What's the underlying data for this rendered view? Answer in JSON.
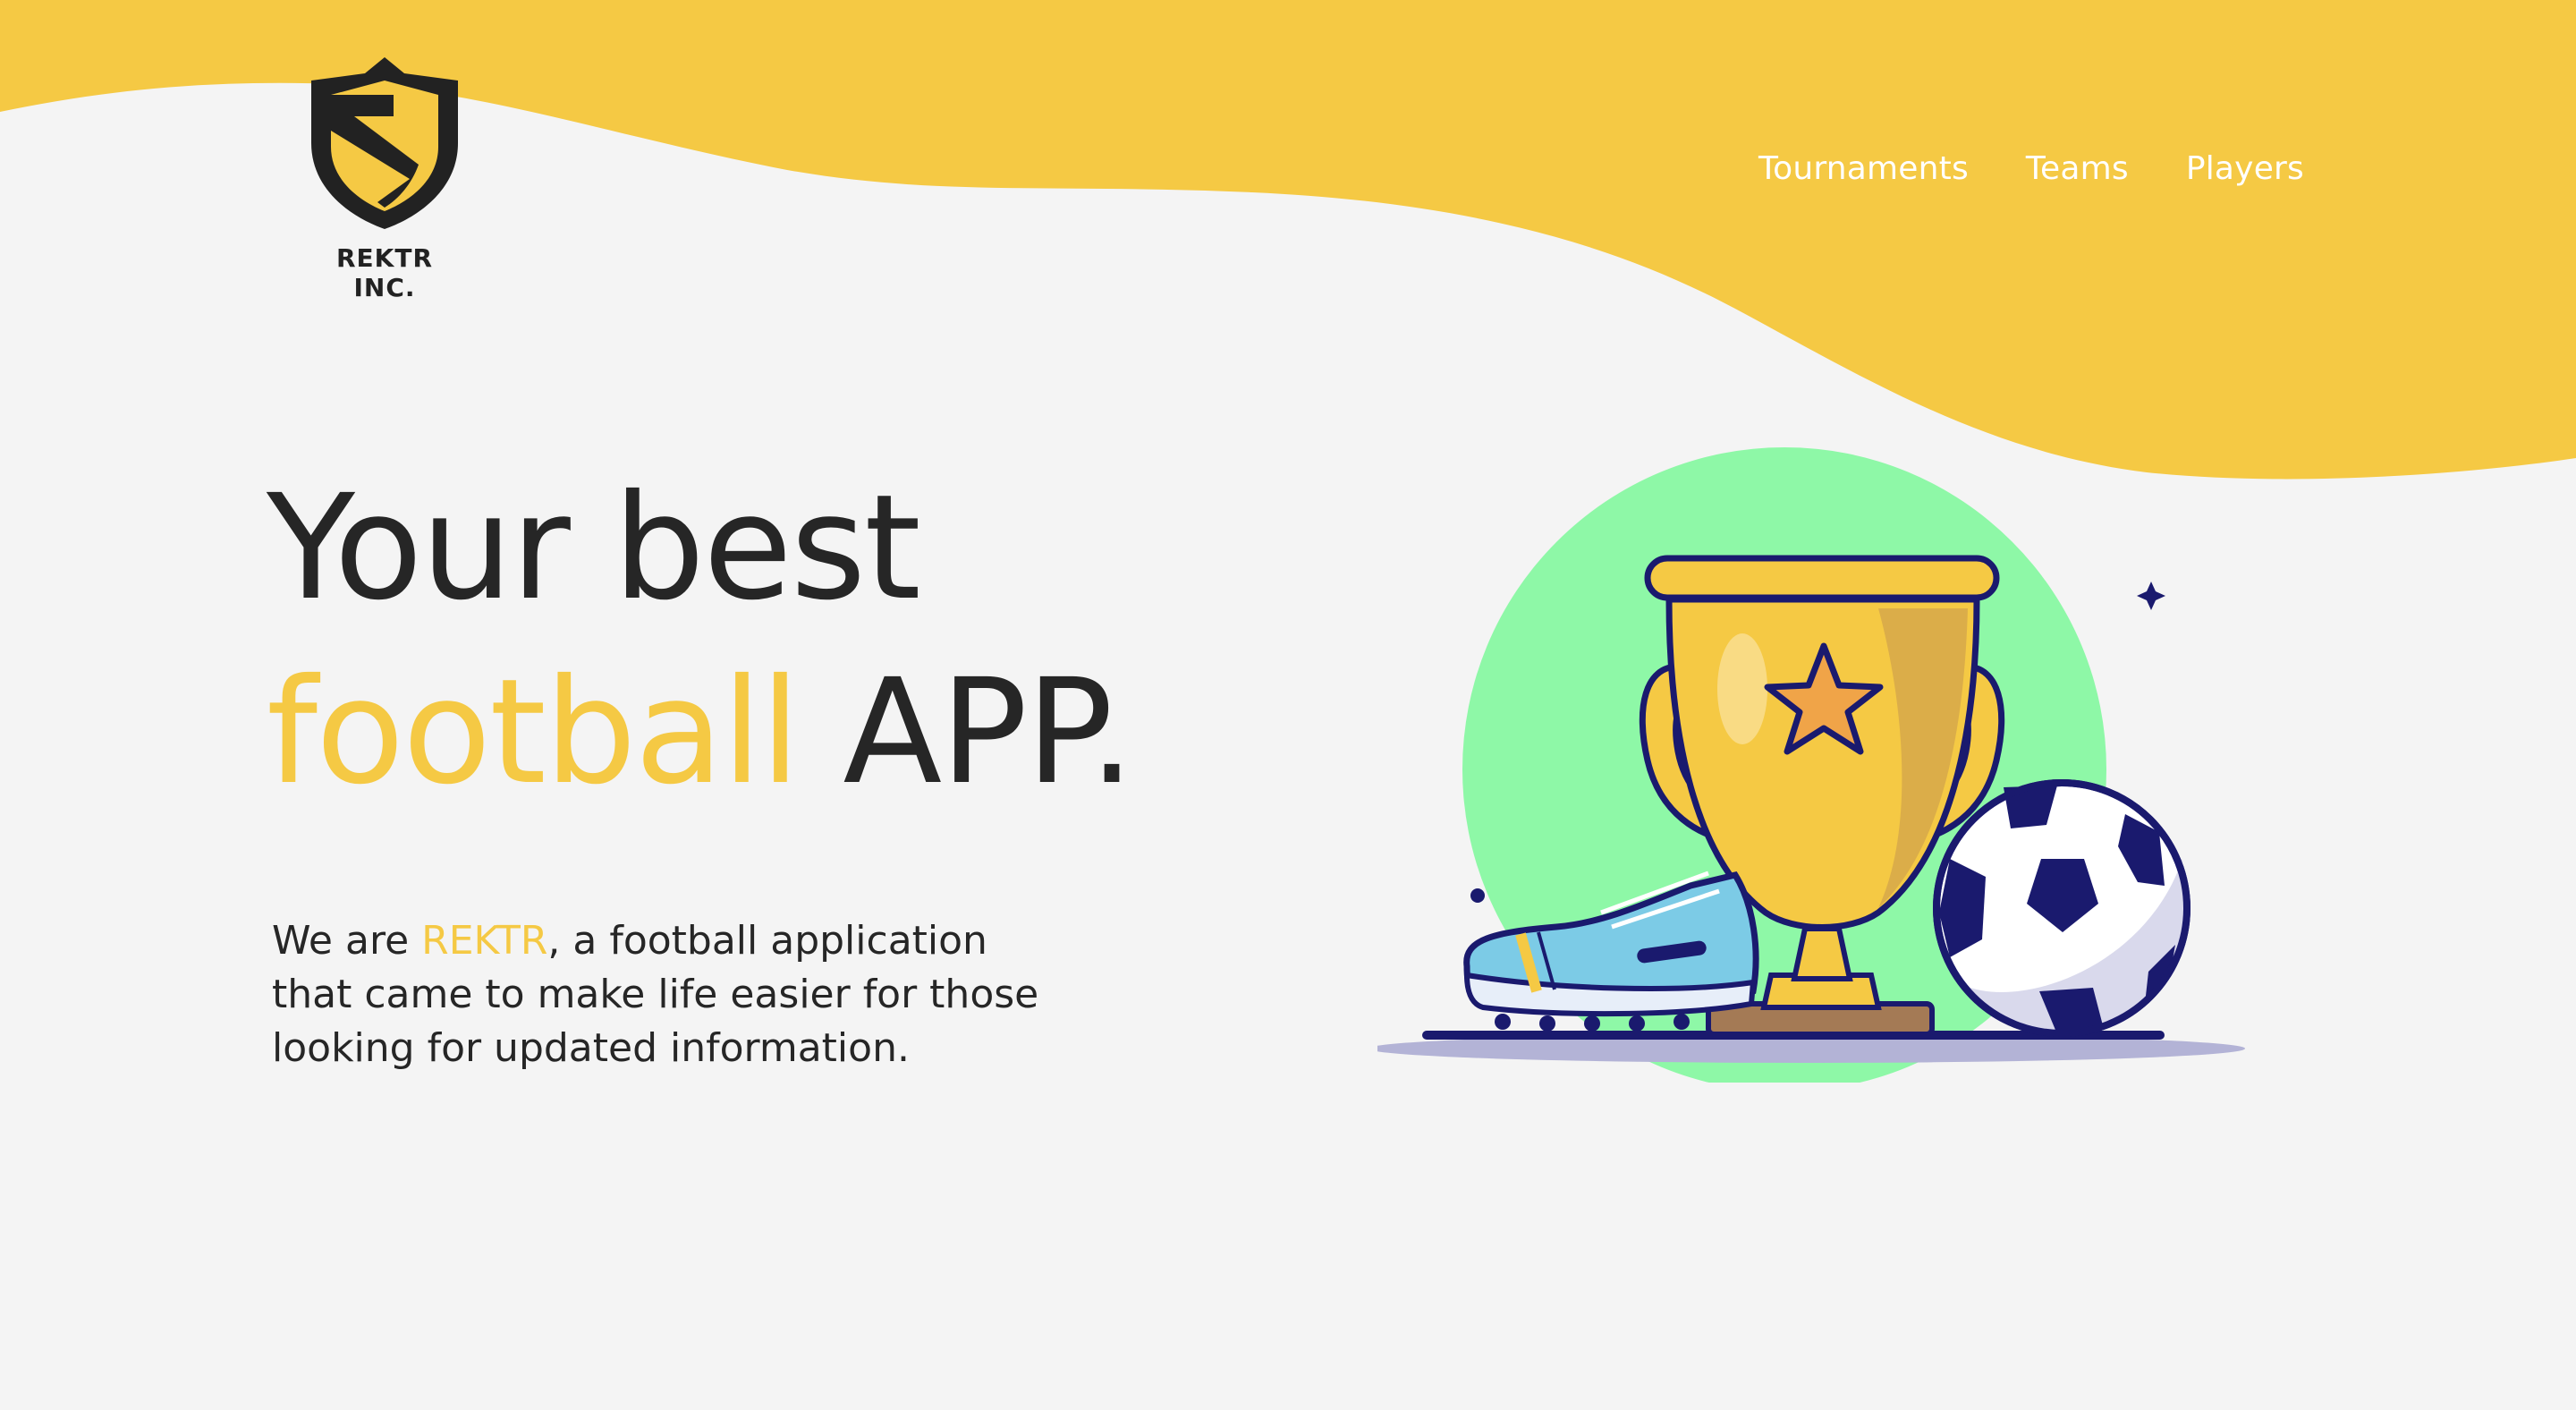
{
  "header": {
    "logo_text": "REKTR INC.",
    "nav": [
      "Tournaments",
      "Teams",
      "Players"
    ]
  },
  "hero": {
    "title_line1": "Your best",
    "title_accent": "football",
    "title_line2_rest": " APP.",
    "desc_before": "We are ",
    "desc_brand": "REKTR",
    "desc_after": ", a football application that came to make life easier for those looking for updated information."
  },
  "colors": {
    "accent": "#f5c944",
    "background": "#f4f4f4",
    "text": "#262626",
    "green_circle": "#8ef8a7",
    "navy": "#1a1a6e"
  },
  "icons": [
    "shield-logo-icon",
    "trophy-icon",
    "football-boot-icon",
    "soccer-ball-icon",
    "sparkle-icon"
  ]
}
